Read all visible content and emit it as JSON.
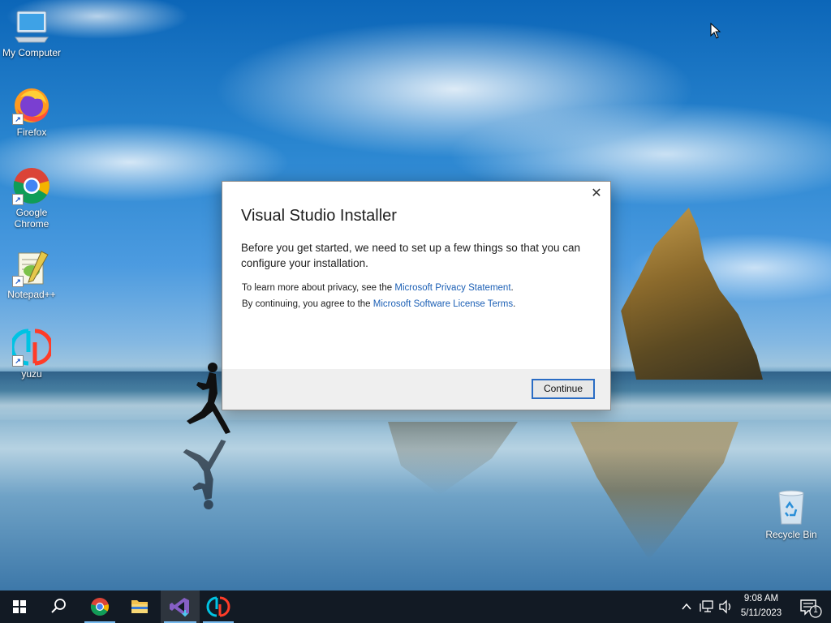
{
  "desktop": {
    "icons": [
      {
        "label": "My Computer"
      },
      {
        "label": "Firefox"
      },
      {
        "label": "Google Chrome"
      },
      {
        "label": "Notepad++"
      },
      {
        "label": "yuzu"
      },
      {
        "label": "Recycle Bin"
      }
    ]
  },
  "dialog": {
    "title": "Visual Studio Installer",
    "lead": "Before you get started, we need to set up a few things so that you can configure your installation.",
    "privacy_prefix": "To learn more about privacy, see the ",
    "privacy_link": "Microsoft Privacy Statement",
    "privacy_suffix": ".",
    "terms_prefix": "By continuing, you agree to the ",
    "terms_link": "Microsoft Software License Terms",
    "terms_suffix": ".",
    "continue_label": "Continue",
    "close_glyph": "✕"
  },
  "taskbar": {
    "apps": [
      "start",
      "search",
      "chrome",
      "file-explorer",
      "visual-studio-installer",
      "yuzu"
    ],
    "active_app": "visual-studio-installer",
    "time": "9:08 AM",
    "date": "5/11/2023",
    "notification_count": "1"
  },
  "colors": {
    "link": "#1b5fb5",
    "button_border": "#2a6cc4",
    "taskbar": "#121a24"
  }
}
